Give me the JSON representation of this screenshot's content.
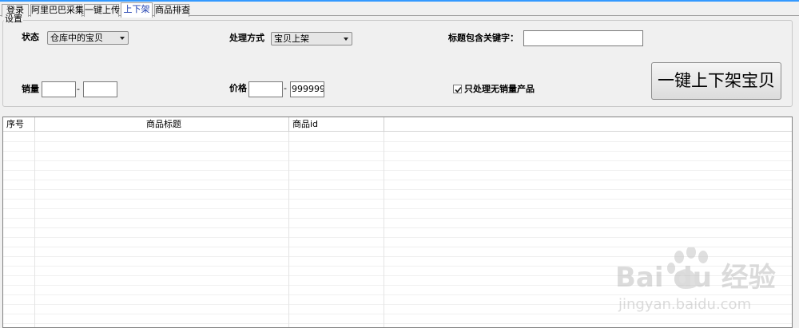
{
  "tabs": [
    {
      "label": "登录",
      "active": false
    },
    {
      "label": "阿里巴巴采集",
      "active": false
    },
    {
      "label": "一键上传",
      "active": false
    },
    {
      "label": "上下架",
      "active": true
    },
    {
      "label": "商品排查",
      "active": false
    }
  ],
  "settings": {
    "group_title": "设置",
    "status": {
      "label": "状态",
      "value": "仓库中的宝贝"
    },
    "method": {
      "label": "处理方式",
      "value": "宝贝上架"
    },
    "keyword": {
      "label": "标题包含关键字：",
      "value": ""
    },
    "sales": {
      "label": "销量",
      "min": "",
      "max": "",
      "sep": "-"
    },
    "price": {
      "label": "价格",
      "min": "",
      "max": "9999999",
      "sep": "-"
    },
    "no_sales_only": {
      "label": "只处理无销量产品",
      "checked": true
    },
    "action_button": "一键上下架宝贝"
  },
  "table": {
    "columns": [
      "序号",
      "商品标题",
      "商品id"
    ],
    "rows": []
  },
  "watermark": {
    "brand": "Bai du 经验",
    "url": "jingyan.baidu.com"
  },
  "colors": {
    "active_tab_text": "#1f3fb0",
    "accent_line": "#3399ff"
  }
}
